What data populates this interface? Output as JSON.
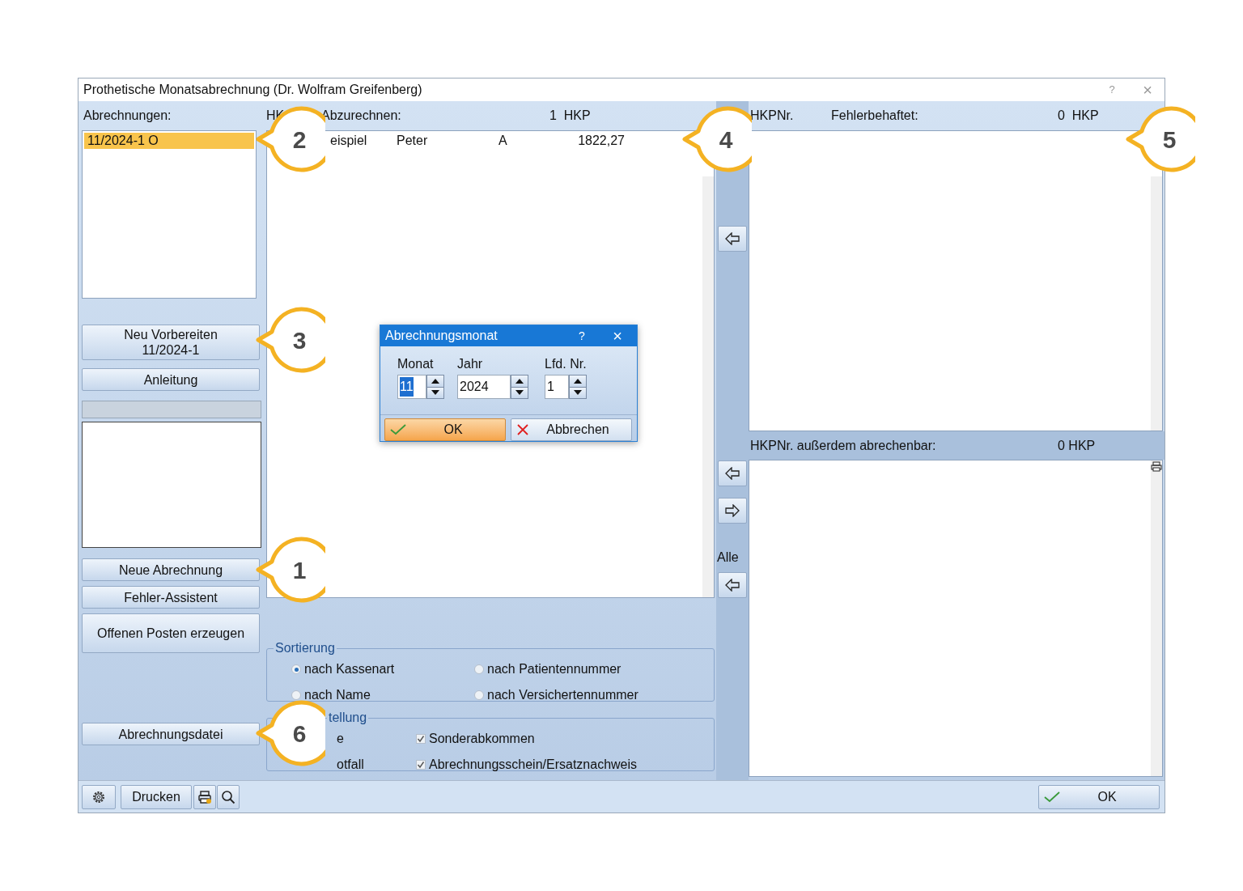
{
  "window": {
    "title": "Prothetische Monatsabrechnung (Dr. Wolfram Greifenberg)",
    "help": "?",
    "close": "×"
  },
  "settlements": {
    "label": "Abrechnungen:",
    "items": [
      {
        "text": "11/2024-1 O",
        "selected": true
      }
    ]
  },
  "left_buttons_top": [
    {
      "lines": [
        "Neu Vorbereiten",
        "11/2024-1"
      ]
    },
    {
      "lines": [
        "Anleitung"
      ]
    }
  ],
  "left_buttons_middle": [
    {
      "lines": [
        "Neue Abrechnung"
      ]
    },
    {
      "lines": [
        "Fehler-Assistent"
      ]
    },
    {
      "lines": [
        "Offenen Posten erzeugen"
      ]
    }
  ],
  "left_buttons_bottom": [
    {
      "lines": [
        "Abrechnungsdatei"
      ]
    }
  ],
  "to_bill": {
    "column_1": "HK",
    "label": "Abzurechnen:",
    "count": "1  HKP",
    "rows": [
      {
        "cells": [
          "eispiel",
          "Peter",
          "A",
          "1822,27"
        ]
      }
    ]
  },
  "all_label": "Alle",
  "faulty": {
    "column_1": "HKPNr.",
    "label": "Fehlerbehaftet:",
    "count": "0  HKP"
  },
  "also_billable": {
    "label": "HKPNr. außerdem abrechenbar:",
    "count": "0 HKP"
  },
  "sorting": {
    "legend": "Sortierung",
    "options": [
      {
        "label": "nach Kassenart",
        "selected": true
      },
      {
        "label": "nach Patientennummer",
        "selected": false
      },
      {
        "label": "nach Name",
        "selected": false
      },
      {
        "label": "nach Versichertennummer",
        "selected": false
      }
    ]
  },
  "display": {
    "legend": "tellung",
    "options": [
      {
        "kind": "text",
        "label": "e"
      },
      {
        "kind": "checkbox",
        "label": "Sonderabkommen",
        "checked": true
      },
      {
        "kind": "text",
        "label": "otfall"
      },
      {
        "kind": "checkbox",
        "label": "Abrechnungsschein/Ersatznachweis",
        "checked": true
      }
    ]
  },
  "footer": {
    "print": "Drucken",
    "ok": "OK"
  },
  "dialog": {
    "title": "Abrechnungsmonat",
    "help": "?",
    "close": "×",
    "fields": [
      {
        "label": "Monat",
        "value": "11",
        "highlighted": true
      },
      {
        "label": "Jahr",
        "value": "2024",
        "highlighted": false
      },
      {
        "label": "Lfd. Nr.",
        "value": "1",
        "highlighted": false
      }
    ],
    "ok": "OK",
    "cancel": "Abbrechen"
  },
  "callouts": [
    {
      "number": "2"
    },
    {
      "number": "3"
    },
    {
      "number": "4"
    },
    {
      "number": "5"
    },
    {
      "number": "1"
    },
    {
      "number": "6"
    }
  ]
}
